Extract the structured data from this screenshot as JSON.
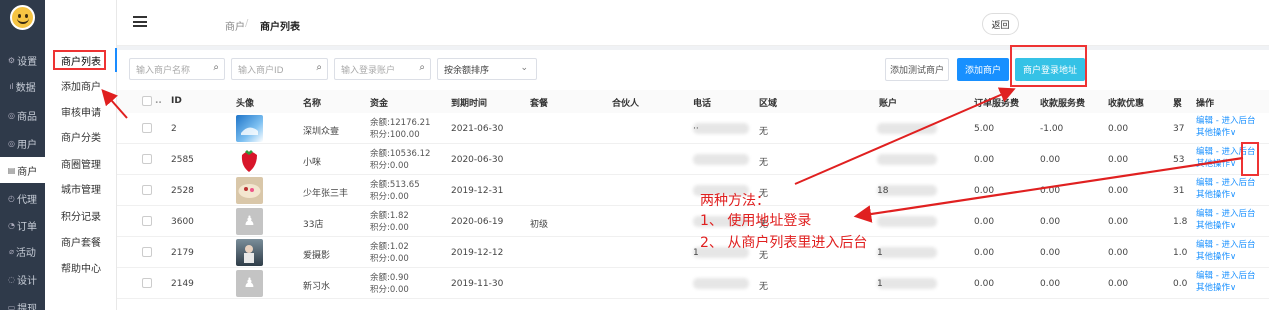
{
  "sidebar_main": [
    {
      "icon": "gear-icon",
      "glyph": "⚙",
      "label": "设置",
      "active": false
    },
    {
      "icon": "chart-icon",
      "glyph": "ıl",
      "label": "数据",
      "active": false
    },
    {
      "icon": "bag-icon",
      "glyph": "◎",
      "label": "商品",
      "active": false
    },
    {
      "icon": "user-icon",
      "glyph": "◎",
      "label": "用户",
      "active": false
    },
    {
      "icon": "store-icon",
      "glyph": "▤",
      "label": "商户",
      "active": true
    },
    {
      "icon": "agent-icon",
      "glyph": "◴",
      "label": "代理",
      "active": false
    },
    {
      "icon": "order-icon",
      "glyph": "◔",
      "label": "订单",
      "active": false
    },
    {
      "icon": "activity-icon",
      "glyph": "⌀",
      "label": "活动",
      "active": false
    },
    {
      "icon": "design-icon",
      "glyph": "◌",
      "label": "设计",
      "active": false
    },
    {
      "icon": "withdraw-icon",
      "glyph": "▭",
      "label": "提现",
      "active": false
    }
  ],
  "sidebar_sub": [
    {
      "label": "商户列表",
      "active": true
    },
    {
      "label": "添加商户"
    },
    {
      "label": "审核申请"
    },
    {
      "label": "商户分类"
    },
    {
      "label": "商圈管理"
    },
    {
      "label": "城市管理"
    },
    {
      "label": "积分记录"
    },
    {
      "label": "商户套餐"
    },
    {
      "label": "帮助中心"
    }
  ],
  "header": {
    "breadcrumb_parent": "商户",
    "breadcrumb_sep": "/",
    "breadcrumb_current": "商户列表",
    "back_label": "返回"
  },
  "toolbar": {
    "search_name_placeholder": "输入商户名称",
    "search_id_placeholder": "输入商户ID",
    "search_account_placeholder": "输入登录账户",
    "sort_value": "按余额排序",
    "add_test_label": "添加测试商户",
    "add_label": "添加商户",
    "login_url_label": "商户登录地址"
  },
  "columns": [
    "ID",
    "头像",
    "名称",
    "资金",
    "到期时间",
    "套餐",
    "合伙人",
    "电话",
    "区域",
    "账户",
    "订单服务费",
    "收款服务费",
    "收款优惠",
    "累",
    "操作"
  ],
  "rows": [
    {
      "id": "2",
      "avatar": "blue",
      "name": "深圳众壹",
      "balance": "余额:12176.21",
      "points": "积分:100.00",
      "expire": "2021-06-30",
      "package": "",
      "partner": "",
      "phone_tail": "··",
      "region": "无",
      "account_tail": "",
      "order_fee": "5.00",
      "pay_fee": "-1.00",
      "discount": "0.00",
      "cum": "37"
    },
    {
      "id": "2585",
      "avatar": "strawberry",
      "name": "小咪",
      "balance": "余额:10536.12",
      "points": "积分:0.00",
      "expire": "2020-06-30",
      "package": "",
      "partner": "",
      "phone_tail": "",
      "region": "无",
      "account_tail": "",
      "order_fee": "0.00",
      "pay_fee": "0.00",
      "discount": "0.00",
      "cum": "53"
    },
    {
      "id": "2528",
      "avatar": "cake",
      "name": "少年张三丰",
      "balance": "余额:513.65",
      "points": "积分:0.00",
      "expire": "2019-12-31",
      "package": "",
      "partner": "",
      "phone_tail": "",
      "region": "无",
      "account_tail": "18",
      "order_fee": "0.00",
      "pay_fee": "0.00",
      "discount": "0.00",
      "cum": "31"
    },
    {
      "id": "3600",
      "avatar": "grey",
      "name": "33店",
      "balance": "余额:1.82",
      "points": "积分:0.00",
      "expire": "2020-06-19",
      "package": "初级",
      "partner": "",
      "phone_tail": "",
      "region": "无",
      "account_tail": "",
      "order_fee": "0.00",
      "pay_fee": "0.00",
      "discount": "0.00",
      "cum": "1.8"
    },
    {
      "id": "2179",
      "avatar": "photo",
      "name": "爱摄影",
      "balance": "余额:1.02",
      "points": "积分:0.00",
      "expire": "2019-12-12",
      "package": "",
      "partner": "",
      "phone_tail": "1",
      "region": "无",
      "account_tail": "1",
      "order_fee": "0.00",
      "pay_fee": "0.00",
      "discount": "0.00",
      "cum": "1.0"
    },
    {
      "id": "2149",
      "avatar": "grey",
      "name": "新习水",
      "balance": "余额:0.90",
      "points": "积分:0.00",
      "expire": "2019-11-30",
      "package": "",
      "partner": "",
      "phone_tail": "",
      "region": "无",
      "account_tail": "1",
      "order_fee": "0.00",
      "pay_fee": "0.00",
      "discount": "0.00",
      "cum": "0.0"
    }
  ],
  "ops": {
    "line1": "编辑 - 进入后台",
    "line2": "其他操作∨"
  },
  "annotation": {
    "title": "两种方法：",
    "line1": "1、 使用地址登录",
    "line2": "2、 从商户列表里进入后台",
    "color": "#e02020"
  }
}
